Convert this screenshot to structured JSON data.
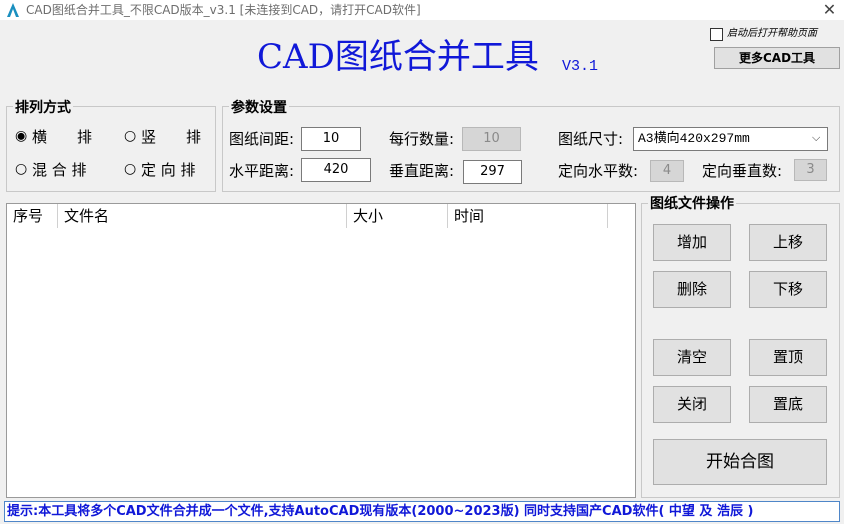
{
  "window": {
    "title": "CAD图纸合并工具_不限CAD版本_v3.1  [未连接到CAD，请打开CAD软件]",
    "close": "✕"
  },
  "header": {
    "title": "CAD图纸合并工具",
    "version": "V3.1",
    "help_checkbox_label": "启动后打开帮助页面",
    "help_checked": false,
    "more_button": "更多CAD工具"
  },
  "arrange": {
    "legend": "排列方式",
    "options": [
      {
        "label": "横　　排",
        "checked": true
      },
      {
        "label": "竖　　排",
        "checked": false
      },
      {
        "label": "混 合 排",
        "checked": false
      },
      {
        "label": "定 向 排",
        "checked": false
      }
    ]
  },
  "params": {
    "legend": "参数设置",
    "spacing_label": "图纸间距:",
    "spacing_value": "10",
    "per_row_label": "每行数量:",
    "per_row_value": "10",
    "size_label": "图纸尺寸:",
    "size_value": "A3横向420x297mm",
    "h_dist_label": "水平距离:",
    "h_dist_value": "420",
    "v_dist_label": "垂直距离:",
    "v_dist_value": "297",
    "h_count_label": "定向水平数:",
    "h_count_value": "4",
    "v_count_label": "定向垂直数:",
    "v_count_value": "3"
  },
  "filelist": {
    "columns": [
      "序号",
      "文件名",
      "大小",
      "时间"
    ],
    "rows": []
  },
  "ops": {
    "legend": "图纸文件操作",
    "add": "增加",
    "up": "上移",
    "delete": "删除",
    "down": "下移",
    "clear": "清空",
    "top": "置顶",
    "close": "关闭",
    "bottom": "置底",
    "merge": "开始合图"
  },
  "status": "提示:本工具将多个CAD文件合并成一个文件,支持AutoCAD现有版本(2000~2023版) 同时支持国产CAD软件( 中望 及 浩辰 )",
  "colors": {
    "accent_blue": "#1018d8",
    "status_border": "#4f86c8"
  }
}
